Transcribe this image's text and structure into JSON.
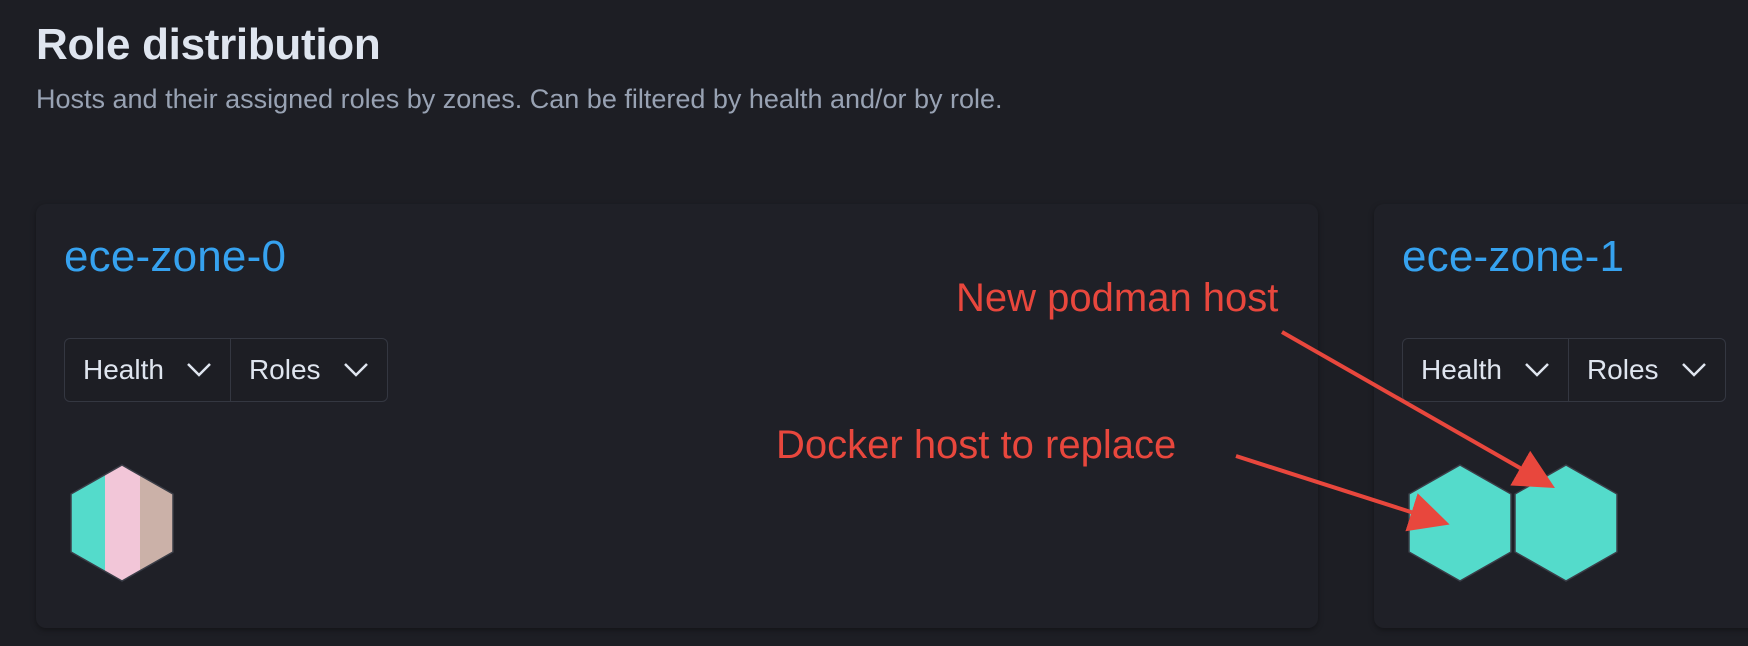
{
  "header": {
    "title": "Role distribution",
    "subtitle": "Hosts and their assigned roles by zones. Can be filtered by health and/or by role."
  },
  "zones": [
    {
      "name": "ece-zone-0",
      "filters": {
        "health_label": "Health",
        "roles_label": "Roles"
      },
      "hosts": [
        {
          "colors": [
            "#54dbcb",
            "#f2c6d8",
            "#cbb1a8"
          ]
        }
      ]
    },
    {
      "name": "ece-zone-1",
      "filters": {
        "health_label": "Health",
        "roles_label": "Roles"
      },
      "hosts": [
        {
          "colors": [
            "#54dbcb"
          ]
        },
        {
          "colors": [
            "#54dbcb"
          ]
        }
      ]
    }
  ],
  "annotations": {
    "new_host": "New podman host",
    "docker_host": "Docker host to replace",
    "color": "#e8473d"
  },
  "theme": {
    "background": "#1d1e24",
    "zone_title_color": "#36a2ef",
    "host_color": "#54dbcb"
  }
}
